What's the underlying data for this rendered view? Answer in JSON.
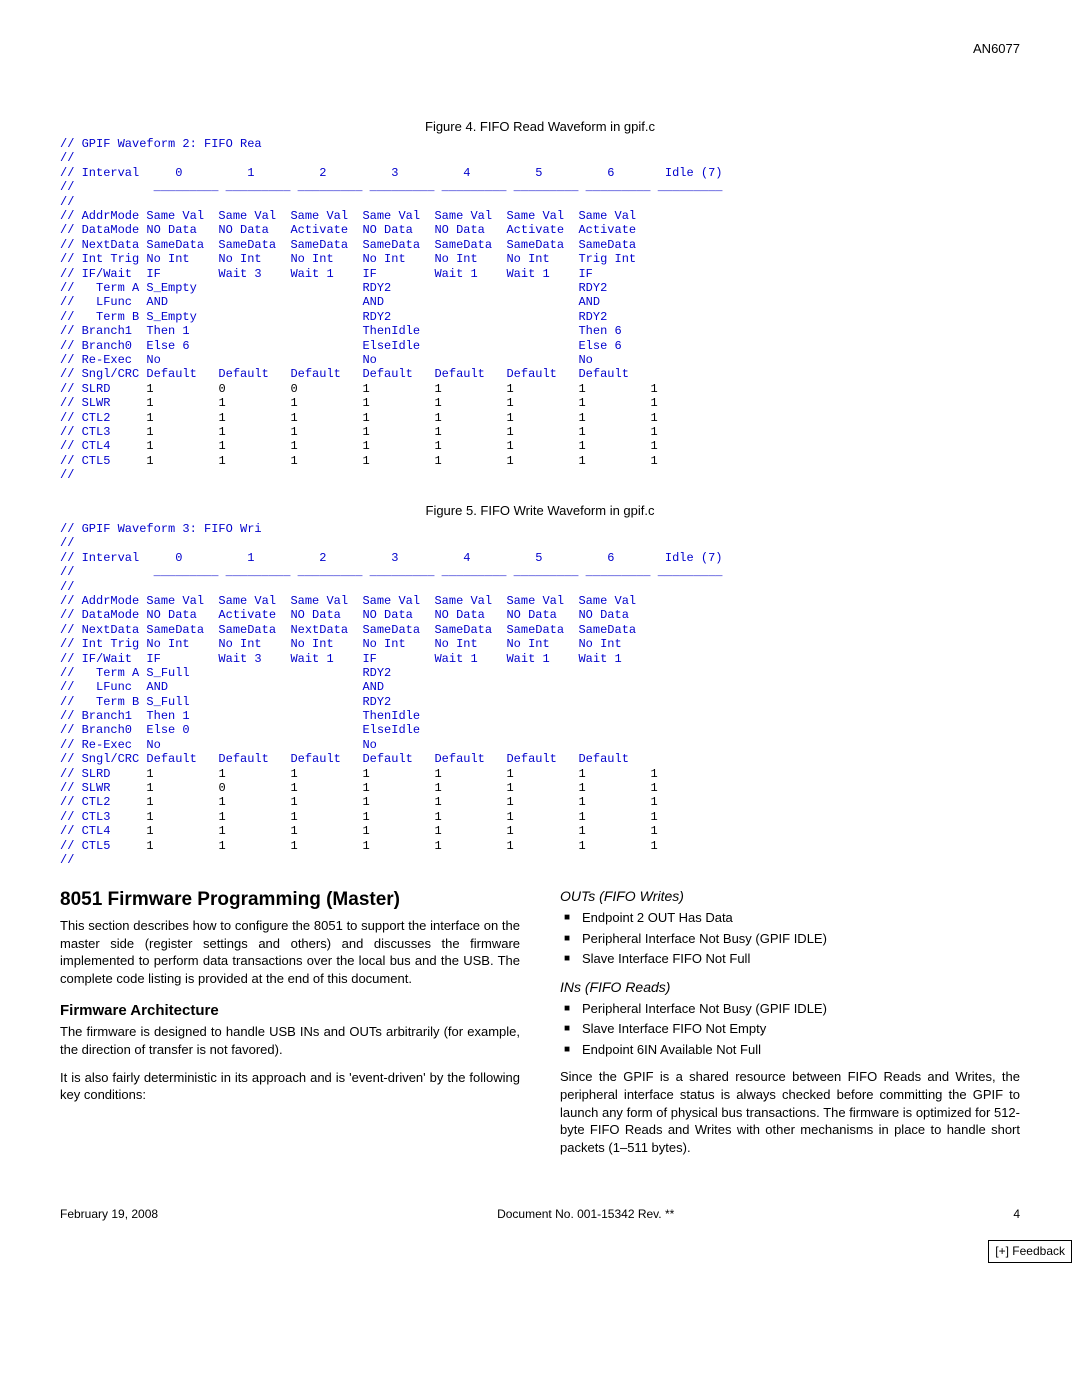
{
  "header": {
    "docnum": "AN6077"
  },
  "figures": {
    "fig4_caption": "Figure 4.  FIFO Read Waveform in gpif.c",
    "fig5_caption": "Figure 5.  FIFO Write Waveform in gpif.c"
  },
  "code4": {
    "title": "// GPIF Waveform 2: FIFO Rea",
    "blank1": "//",
    "interval": "// Interval     0         1         2         3         4         5         6       Idle (7)",
    "blank2": "//           _________ _________ _________ _________ _________ _________ _________ _________",
    "blank3": "//",
    "rows": [
      {
        "lbl": "// AddrMode",
        "c": [
          "Same Val",
          "Same Val",
          "Same Val",
          "Same Val",
          "Same Val",
          "Same Val",
          "Same Val"
        ]
      },
      {
        "lbl": "// DataMode",
        "c": [
          "NO Data",
          "NO Data",
          "Activate",
          "NO Data",
          "NO Data",
          "Activate",
          "Activate"
        ]
      },
      {
        "lbl": "// NextData",
        "c": [
          "SameData",
          "SameData",
          "SameData",
          "SameData",
          "SameData",
          "SameData",
          "SameData"
        ]
      },
      {
        "lbl": "// Int Trig",
        "c": [
          "No Int",
          "No Int",
          "No Int",
          "No Int",
          "No Int",
          "No Int",
          "Trig Int"
        ]
      },
      {
        "lbl": "// IF/Wait ",
        "c": [
          "IF",
          "Wait 3",
          "Wait 1",
          "IF",
          "Wait 1",
          "Wait 1",
          "IF"
        ]
      },
      {
        "lbl": "//   Term A",
        "c": [
          "S_Empty",
          "",
          "",
          "RDY2",
          "",
          "",
          "RDY2"
        ]
      },
      {
        "lbl": "//   LFunc ",
        "c": [
          "AND",
          "",
          "",
          "AND",
          "",
          "",
          "AND"
        ]
      },
      {
        "lbl": "//   Term B",
        "c": [
          "S_Empty",
          "",
          "",
          "RDY2",
          "",
          "",
          "RDY2"
        ]
      },
      {
        "lbl": "// Branch1 ",
        "c": [
          "Then 1",
          "",
          "",
          "ThenIdle",
          "",
          "",
          "Then 6"
        ]
      },
      {
        "lbl": "// Branch0 ",
        "c": [
          "Else 6",
          "",
          "",
          "ElseIdle",
          "",
          "",
          "Else 6"
        ]
      },
      {
        "lbl": "// Re-Exec ",
        "c": [
          "No",
          "",
          "",
          "No",
          "",
          "",
          "No"
        ]
      },
      {
        "lbl": "// Sngl/CRC",
        "c": [
          "Default",
          "Default",
          "Default",
          "Default",
          "Default",
          "Default",
          "Default"
        ]
      }
    ],
    "sigrows": [
      {
        "lbl": "// SLRD    ",
        "c": [
          "1",
          "0",
          "0",
          "1",
          "1",
          "1",
          "1"
        ]
      },
      {
        "lbl": "// SLWR    ",
        "c": [
          "1",
          "1",
          "1",
          "1",
          "1",
          "1",
          "1"
        ]
      },
      {
        "lbl": "// CTL2    ",
        "c": [
          "1",
          "1",
          "1",
          "1",
          "1",
          "1",
          "1"
        ]
      },
      {
        "lbl": "// CTL3    ",
        "c": [
          "1",
          "1",
          "1",
          "1",
          "1",
          "1",
          "1"
        ]
      },
      {
        "lbl": "// CTL4    ",
        "c": [
          "1",
          "1",
          "1",
          "1",
          "1",
          "1",
          "1"
        ]
      },
      {
        "lbl": "// CTL5    ",
        "c": [
          "1",
          "1",
          "1",
          "1",
          "1",
          "1",
          "1"
        ]
      }
    ],
    "blank_end": "//"
  },
  "code5": {
    "title": "// GPIF Waveform 3: FIFO Wri",
    "blank1": "//",
    "interval": "// Interval     0         1         2         3         4         5         6       Idle (7)",
    "blank2": "//           _________ _________ _________ _________ _________ _________ _________ _________",
    "blank3": "//",
    "rows": [
      {
        "lbl": "// AddrMode",
        "c": [
          "Same Val",
          "Same Val",
          "Same Val",
          "Same Val",
          "Same Val",
          "Same Val",
          "Same Val"
        ]
      },
      {
        "lbl": "// DataMode",
        "c": [
          "NO Data",
          "Activate",
          "NO Data",
          "NO Data",
          "NO Data",
          "NO Data",
          "NO Data"
        ]
      },
      {
        "lbl": "// NextData",
        "c": [
          "SameData",
          "SameData",
          "NextData",
          "SameData",
          "SameData",
          "SameData",
          "SameData"
        ]
      },
      {
        "lbl": "// Int Trig",
        "c": [
          "No Int",
          "No Int",
          "No Int",
          "No Int",
          "No Int",
          "No Int",
          "No Int"
        ]
      },
      {
        "lbl": "// IF/Wait ",
        "c": [
          "IF",
          "Wait 3",
          "Wait 1",
          "IF",
          "Wait 1",
          "Wait 1",
          "Wait 1"
        ]
      },
      {
        "lbl": "//   Term A",
        "c": [
          "S_Full",
          "",
          "",
          "RDY2",
          "",
          "",
          ""
        ]
      },
      {
        "lbl": "//   LFunc ",
        "c": [
          "AND",
          "",
          "",
          "AND",
          "",
          "",
          ""
        ]
      },
      {
        "lbl": "//   Term B",
        "c": [
          "S_Full",
          "",
          "",
          "RDY2",
          "",
          "",
          ""
        ]
      },
      {
        "lbl": "// Branch1 ",
        "c": [
          "Then 1",
          "",
          "",
          "ThenIdle",
          "",
          "",
          ""
        ]
      },
      {
        "lbl": "// Branch0 ",
        "c": [
          "Else 0",
          "",
          "",
          "ElseIdle",
          "",
          "",
          ""
        ]
      },
      {
        "lbl": "// Re-Exec ",
        "c": [
          "No",
          "",
          "",
          "No",
          "",
          "",
          ""
        ]
      },
      {
        "lbl": "// Sngl/CRC",
        "c": [
          "Default",
          "Default",
          "Default",
          "Default",
          "Default",
          "Default",
          "Default"
        ]
      }
    ],
    "sigrows": [
      {
        "lbl": "// SLRD    ",
        "c": [
          "1",
          "1",
          "1",
          "1",
          "1",
          "1",
          "1"
        ]
      },
      {
        "lbl": "// SLWR    ",
        "c": [
          "1",
          "0",
          "1",
          "1",
          "1",
          "1",
          "1"
        ]
      },
      {
        "lbl": "// CTL2    ",
        "c": [
          "1",
          "1",
          "1",
          "1",
          "1",
          "1",
          "1"
        ]
      },
      {
        "lbl": "// CTL3    ",
        "c": [
          "1",
          "1",
          "1",
          "1",
          "1",
          "1",
          "1"
        ]
      },
      {
        "lbl": "// CTL4    ",
        "c": [
          "1",
          "1",
          "1",
          "1",
          "1",
          "1",
          "1"
        ]
      },
      {
        "lbl": "// CTL5    ",
        "c": [
          "1",
          "1",
          "1",
          "1",
          "1",
          "1",
          "1"
        ]
      }
    ],
    "blank_end": "//"
  },
  "body": {
    "h1": "8051 Firmware Programming (Master)",
    "p1": "This section describes how to configure the 8051 to support the interface on the master side (register settings and others) and discusses the firmware implemented to perform data transactions over the local bus and the USB. The complete code listing is provided at the end of this document.",
    "h2": "Firmware Architecture",
    "p2": "The firmware is designed to handle USB INs and OUTs arbitrarily (for example, the direction of transfer is not favored).",
    "p3": "It is also fairly deterministic in its approach and is 'event-driven' by the following key conditions:",
    "h3a": "OUTs (FIFO Writes)",
    "outs": [
      "Endpoint 2 OUT Has Data",
      "Peripheral Interface Not Busy (GPIF IDLE)",
      "Slave Interface FIFO Not Full"
    ],
    "h3b": "INs (FIFO Reads)",
    "ins": [
      "Peripheral Interface Not Busy (GPIF IDLE)",
      "Slave Interface FIFO Not Empty",
      "Endpoint 6IN Available Not Full"
    ],
    "p4": "Since the GPIF is a shared resource between FIFO Reads and Writes, the peripheral interface status is always checked before committing the GPIF to launch any form of physical bus transactions. The firmware is optimized for 512-byte FIFO Reads and Writes with other mechanisms in place to handle short packets (1–511 bytes)."
  },
  "footer": {
    "date": "February 19, 2008",
    "docrev": "Document No. 001-15342 Rev. **",
    "page": "4",
    "feedback": "[+] Feedback"
  }
}
